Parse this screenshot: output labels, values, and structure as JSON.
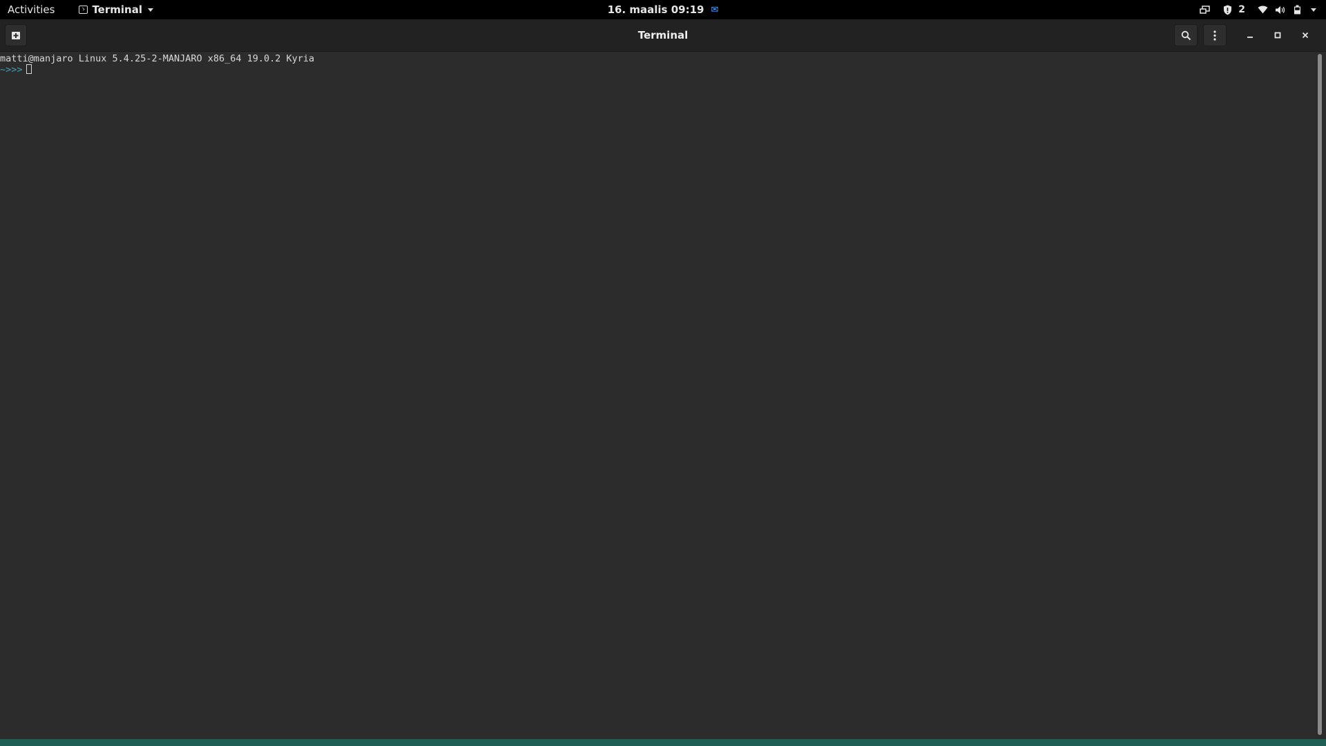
{
  "topbar": {
    "activities_label": "Activities",
    "app_menu_label": "Terminal",
    "clock": "16. maalis 09:19",
    "notification_count": "2"
  },
  "window": {
    "title": "Terminal"
  },
  "terminal": {
    "motd_line": "matti@manjaro Linux 5.4.25-2-MANJARO x86_64 19.0.2 Kyria",
    "prompt_dir": "~",
    "prompt_arrows": ">>>"
  },
  "colors": {
    "topbar": "#000000",
    "titlebar": "#222222",
    "terminal_bg": "#2c2c2c",
    "prompt_accent": "#3fa0ba",
    "bottom_strip": "#1f5e54"
  }
}
